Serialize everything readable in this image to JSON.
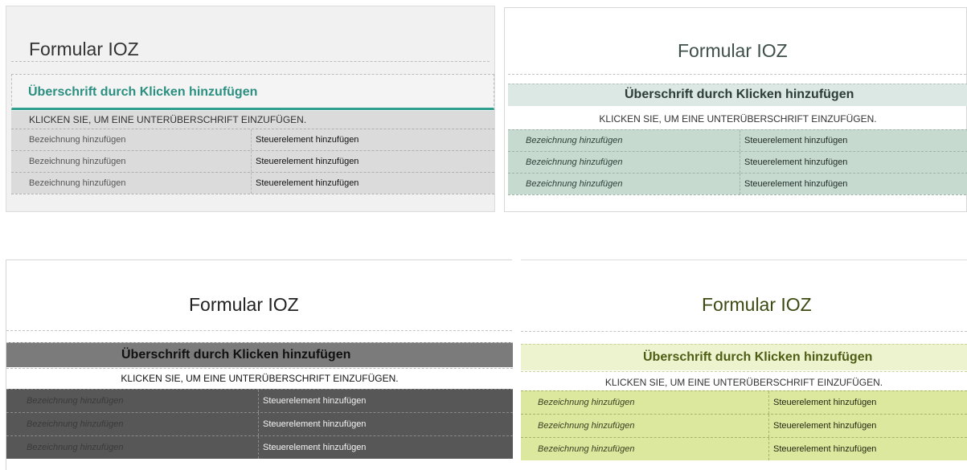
{
  "panels": [
    {
      "title": "Formular IOZ",
      "heading": "Überschrift durch Klicken hinzufügen",
      "subheading": "KLICKEN SIE, UM EINE UNTERÜBERSCHRIFT EINZUFÜGEN.",
      "rows": [
        {
          "label": "Bezeichnung hinzufügen",
          "control": "Steuerelement hinzufügen"
        },
        {
          "label": "Bezeichnung hinzufügen",
          "control": "Steuerelement hinzufügen"
        },
        {
          "label": "Bezeichnung hinzufügen",
          "control": "Steuerelement hinzufügen"
        }
      ]
    },
    {
      "title": "Formular IOZ",
      "heading": "Überschrift durch Klicken hinzufügen",
      "subheading": "KLICKEN SIE, UM EINE UNTERÜBERSCHRIFT EINZUFÜGEN.",
      "rows": [
        {
          "label": "Bezeichnung hinzufügen",
          "control": "Steuerelement hinzufügen"
        },
        {
          "label": "Bezeichnung hinzufügen",
          "control": "Steuerelement hinzufügen"
        },
        {
          "label": "Bezeichnung hinzufügen",
          "control": "Steuerelement hinzufügen"
        }
      ]
    },
    {
      "title": "Formular IOZ",
      "heading": "Überschrift durch Klicken hinzufügen",
      "subheading": "KLICKEN SIE, UM EINE UNTERÜBERSCHRIFT EINZUFÜGEN.",
      "rows": [
        {
          "label": "Bezeichnung hinzufügen",
          "control": "Steuerelement hinzufügen"
        },
        {
          "label": "Bezeichnung hinzufügen",
          "control": "Steuerelement hinzufügen"
        },
        {
          "label": "Bezeichnung hinzufügen",
          "control": "Steuerelement hinzufügen"
        }
      ]
    },
    {
      "title": "Formular IOZ",
      "heading": "Überschrift durch Klicken hinzufügen",
      "subheading": "KLICKEN SIE, UM EINE UNTERÜBERSCHRIFT EINZUFÜGEN.",
      "rows": [
        {
          "label": "Bezeichnung hinzufügen",
          "control": "Steuerelement hinzufügen"
        },
        {
          "label": "Bezeichnung hinzufügen",
          "control": "Steuerelement hinzufügen"
        },
        {
          "label": "Bezeichnung hinzufügen",
          "control": "Steuerelement hinzufügen"
        }
      ]
    }
  ],
  "colors": {
    "panel1_accent": "#2a8f80",
    "panel2_band": "#c7dacf",
    "panel3_band": "#575757",
    "panel4_band": "#dde89f"
  }
}
